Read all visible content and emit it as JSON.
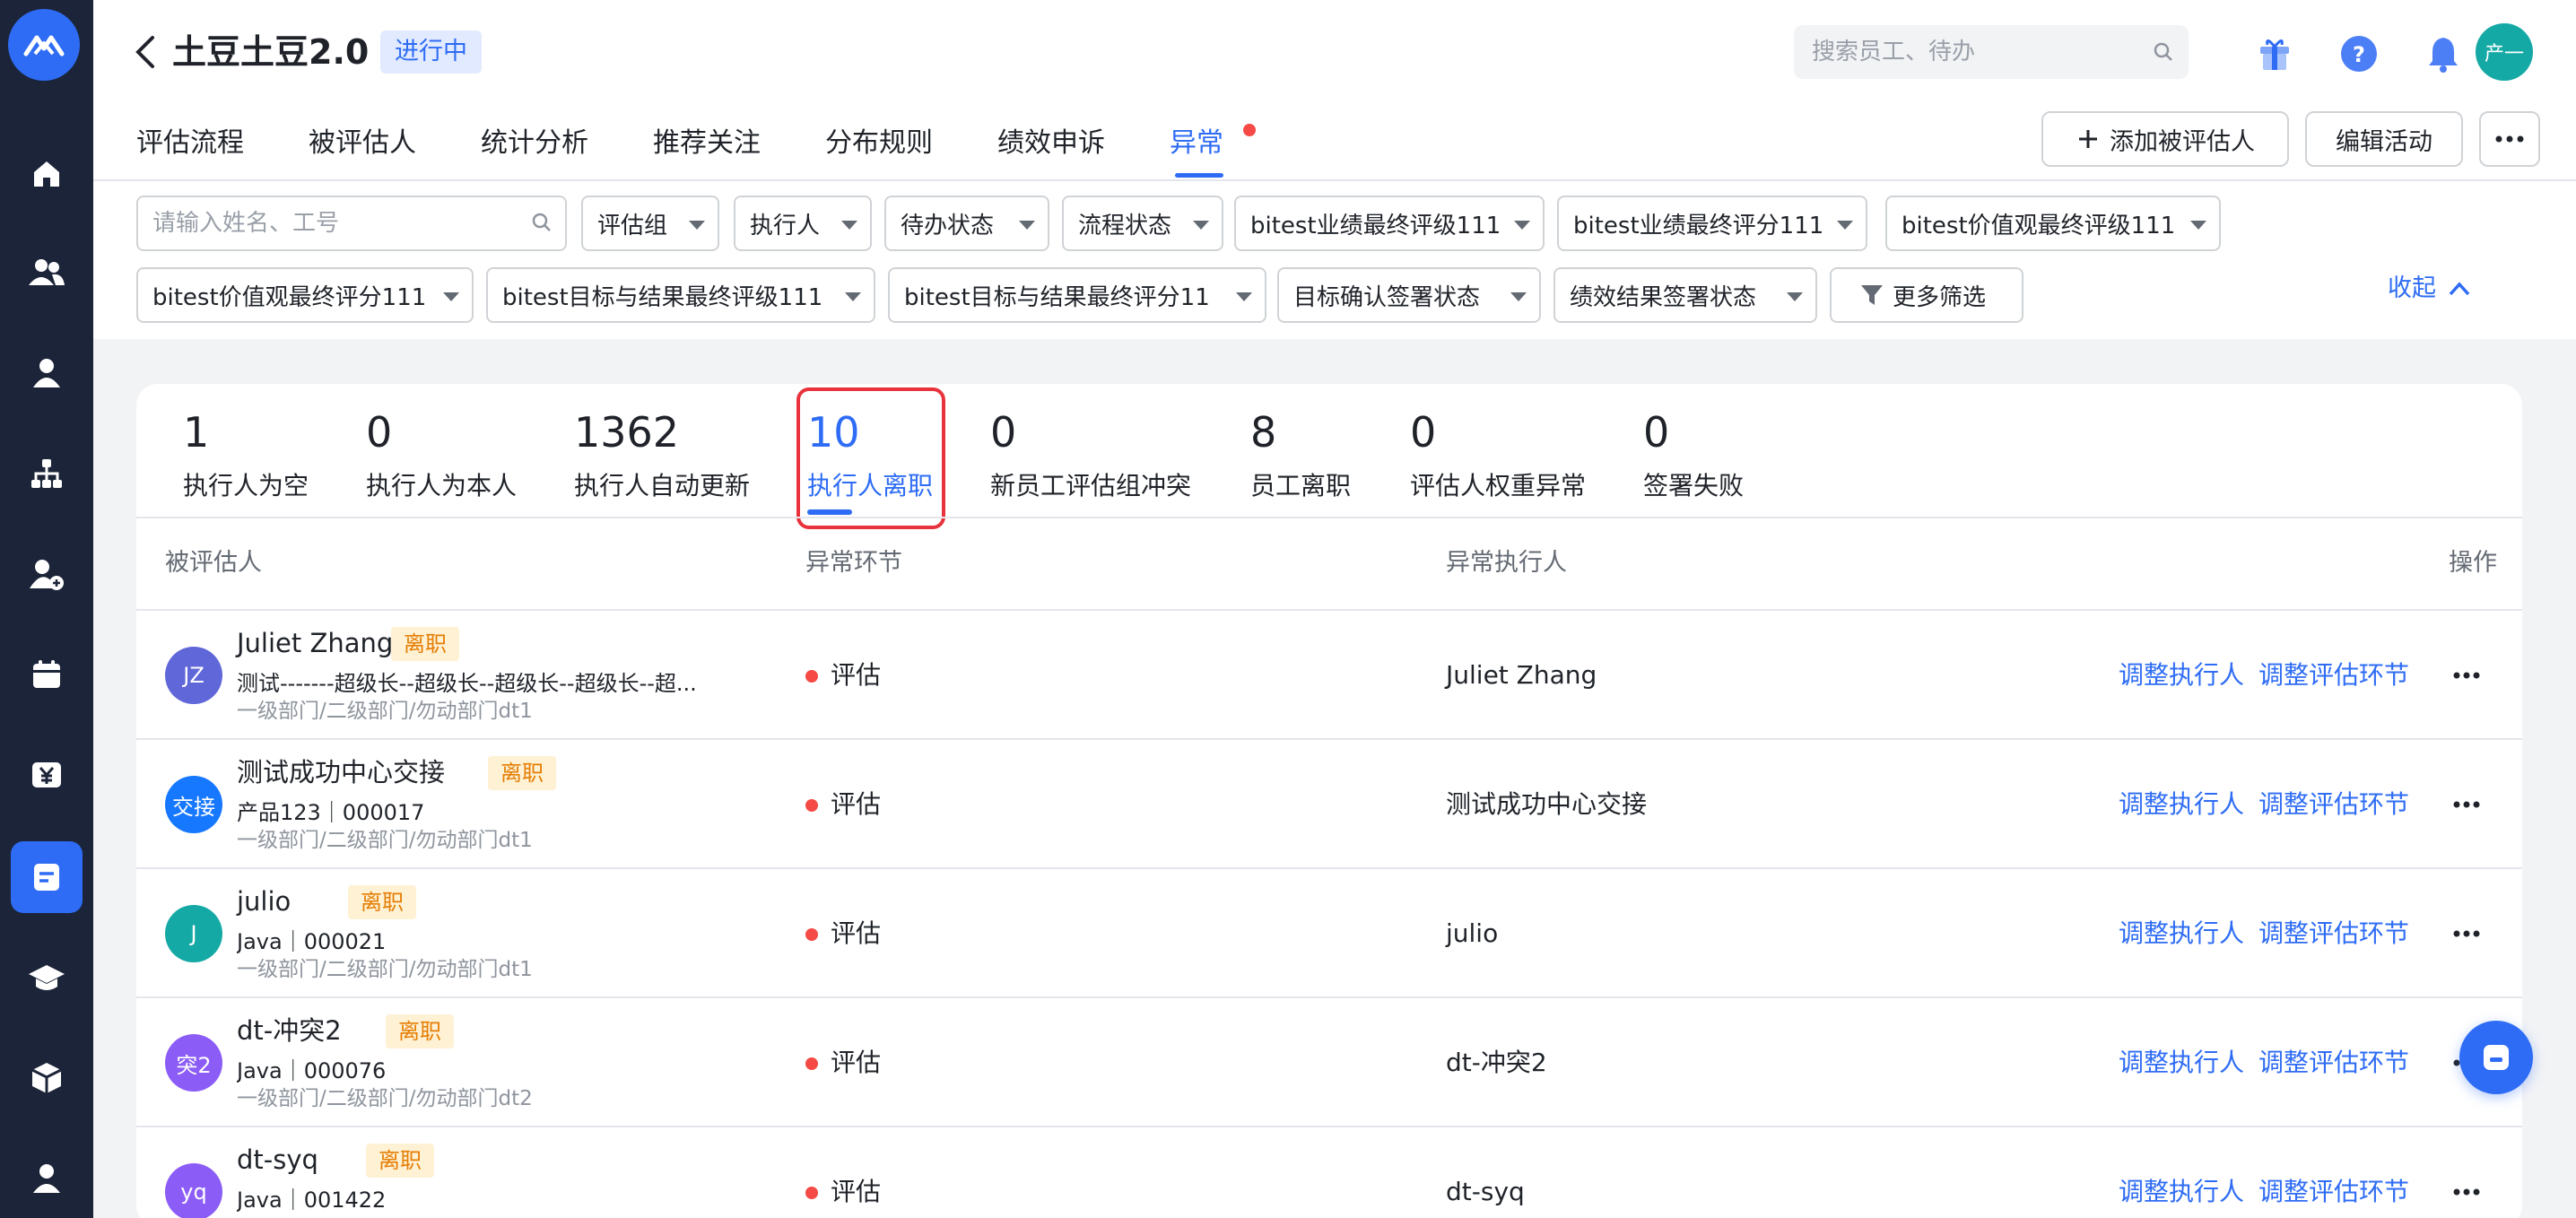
{
  "header": {
    "title": "土豆土豆2.0",
    "status": "进行中",
    "search_placeholder": "搜索员工、待办",
    "avatar_text": "产一"
  },
  "tabs": [
    {
      "label": "评估流程"
    },
    {
      "label": "被评估人"
    },
    {
      "label": "统计分析"
    },
    {
      "label": "推荐关注"
    },
    {
      "label": "分布规则"
    },
    {
      "label": "绩效申诉"
    },
    {
      "label": "异常",
      "active": true
    }
  ],
  "actions": {
    "add": "添加被评估人",
    "edit": "编辑活动"
  },
  "filters": {
    "name_placeholder": "请输入姓名、工号",
    "chips": [
      "评估组",
      "执行人",
      "待办状态",
      "流程状态",
      "bitest业绩最终评级111",
      "bitest业绩最终评分111",
      "bitest价值观最终评级111",
      "bitest价值观最终评分111",
      "bitest目标与结果最终评级111",
      "bitest目标与结果最终评分11",
      "目标确认签署状态",
      "绩效结果签署状态"
    ],
    "more": "更多筛选",
    "collapse": "收起"
  },
  "stats": [
    {
      "num": "1",
      "label": "执行人为空"
    },
    {
      "num": "0",
      "label": "执行人为本人"
    },
    {
      "num": "1362",
      "label": "执行人自动更新"
    },
    {
      "num": "10",
      "label": "执行人离职",
      "active": true
    },
    {
      "num": "0",
      "label": "新员工评估组冲突"
    },
    {
      "num": "8",
      "label": "员工离职"
    },
    {
      "num": "0",
      "label": "评估人权重异常"
    },
    {
      "num": "0",
      "label": "签署失败"
    }
  ],
  "table": {
    "headers": {
      "person": "被评估人",
      "stage": "异常环节",
      "executor": "异常执行人",
      "ops": "操作"
    },
    "rows": [
      {
        "avatar": "JZ",
        "avatar_color": "#6067d8",
        "name": "Juliet Zhang",
        "badge": "离职",
        "sub": "测试-------超级长--超级长--超级长--超级长--超...",
        "dept": "一级部门/二级部门/勿动部门dt1",
        "stage": "评估",
        "executor": "Juliet Zhang",
        "action1": "调整执行人",
        "action2": "调整评估环节"
      },
      {
        "avatar": "交接",
        "avatar_color": "#1677ff",
        "name": "测试成功中心交接",
        "badge": "离职",
        "sub": "产品123｜000017",
        "dept": "一级部门/二级部门/勿动部门dt1",
        "stage": "评估",
        "executor": "测试成功中心交接",
        "action1": "调整执行人",
        "action2": "调整评估环节"
      },
      {
        "avatar": "J",
        "avatar_color": "#14a9a5",
        "name": "julio",
        "badge": "离职",
        "sub": "Java｜000021",
        "dept": "一级部门/二级部门/勿动部门dt1",
        "stage": "评估",
        "executor": "julio",
        "action1": "调整执行人",
        "action2": "调整评估环节"
      },
      {
        "avatar": "突2",
        "avatar_color": "#8b5cf6",
        "name": "dt-冲突2",
        "badge": "离职",
        "sub": "Java｜000076",
        "dept": "一级部门/二级部门/勿动部门dt2",
        "stage": "评估",
        "executor": "dt-冲突2",
        "action1": "调整执行人",
        "action2": "调整评估环节"
      },
      {
        "avatar": "yq",
        "avatar_color": "#8b5cf6",
        "name": "dt-syq",
        "badge": "离职",
        "sub": "Java｜001422",
        "dept": "",
        "stage": "评估",
        "executor": "dt-syq",
        "action1": "调整执行人",
        "action2": "调整评估环节"
      }
    ]
  },
  "colors": {
    "accent": "#2e6cf5",
    "sidebar": "#1b2438",
    "warning_badge": "#e57e05",
    "error_dot": "#f54a45"
  }
}
